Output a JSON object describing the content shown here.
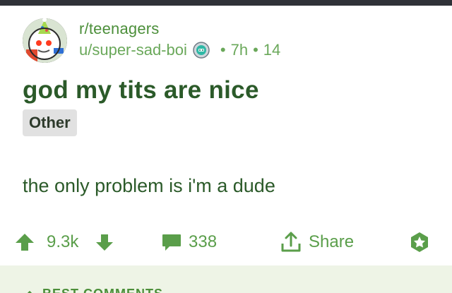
{
  "post": {
    "subreddit_prefix": "r/",
    "subreddit": "teenagers",
    "author": "u/super-sad-boi",
    "age": "7h",
    "comments_meta": "14",
    "title": "god my tits are nice",
    "flair": "Other",
    "body": "the only problem is i'm a dude"
  },
  "actions": {
    "upvotes": "9.3k",
    "comments": "338",
    "share_label": "Share"
  },
  "comments_section": {
    "sort_label": "BEST COMMENTS"
  },
  "colors": {
    "topbar": "#2f3238",
    "accent_green": "#5a9e4a",
    "title_green": "#2b5a29",
    "comments_bg": "#eef4e6",
    "flair_bg": "#e1e1e1"
  },
  "icons": {
    "upvote": "arrow-up-icon",
    "downvote": "arrow-down-icon",
    "comment": "speech-bubble-icon",
    "share": "share-upload-icon",
    "award": "star-award-icon",
    "user_flair": "robot-badge-icon",
    "sort": "chevron-up-icon"
  }
}
